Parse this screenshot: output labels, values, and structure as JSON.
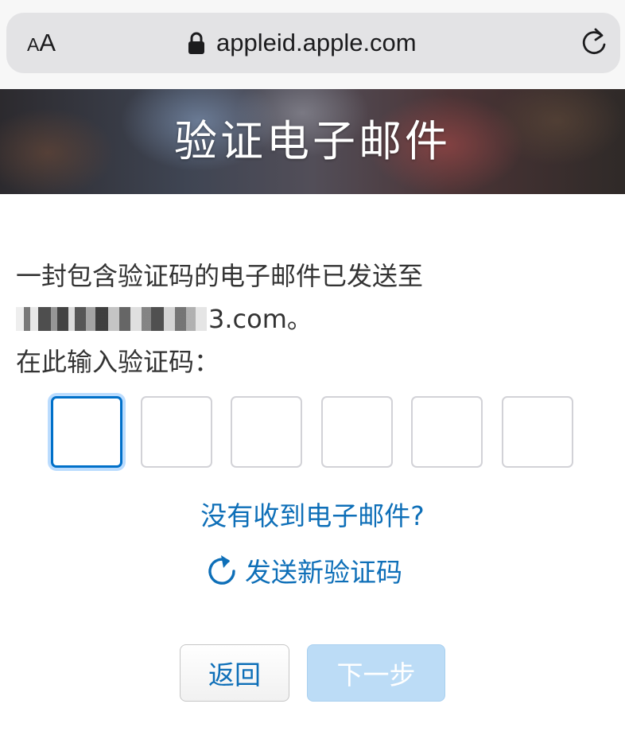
{
  "browser": {
    "text_size_small": "A",
    "text_size_large": "A",
    "url": "appleid.apple.com"
  },
  "banner": {
    "title": "验证电子邮件"
  },
  "message": {
    "line1": "一封包含验证码的电子邮件已发送至",
    "email_visible_suffix": "3.com。",
    "line3": "在此输入验证码："
  },
  "code_inputs": {
    "count": 6,
    "values": [
      "",
      "",
      "",
      "",
      "",
      ""
    ],
    "active_index": 0
  },
  "links": {
    "no_email": "没有收到电子邮件?",
    "resend": "发送新验证码"
  },
  "buttons": {
    "back": "返回",
    "next": "下一步",
    "next_disabled": true
  },
  "colors": {
    "link_blue": "#0e6fb8",
    "focus_blue": "#0070c9",
    "disabled_button": "#bcdcf6"
  },
  "icons": {
    "lock": "lock-icon",
    "reload": "reload-icon",
    "resend": "refresh-icon"
  }
}
